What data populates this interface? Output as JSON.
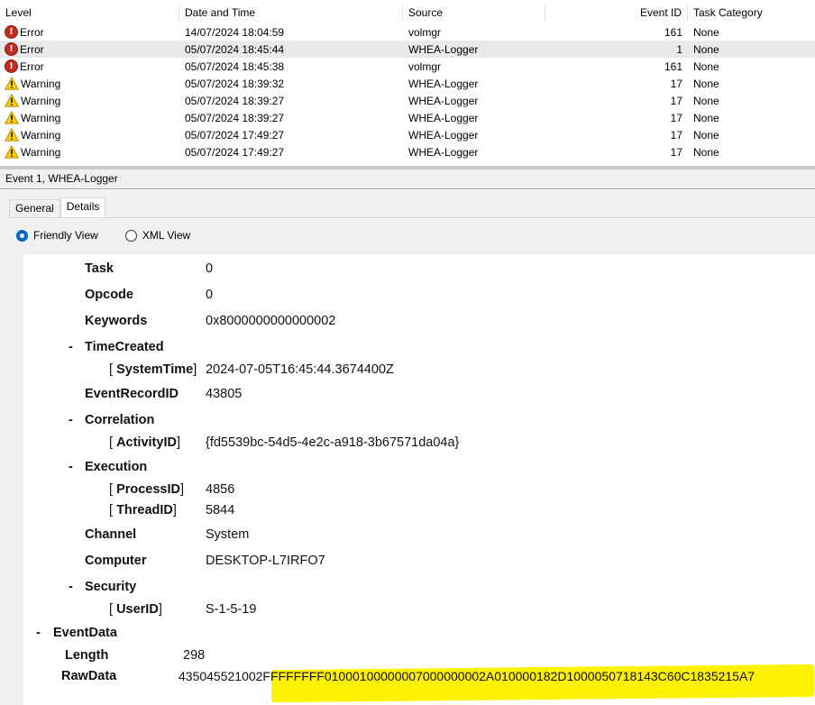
{
  "list": {
    "columns": [
      {
        "label": "Level"
      },
      {
        "label": "Date and Time"
      },
      {
        "label": "Source"
      },
      {
        "label": "Event ID"
      },
      {
        "label": "Task Category"
      }
    ],
    "rows": [
      {
        "level": "Error",
        "icon": "error-icon",
        "datetime": "14/07/2024 18:04:59",
        "source": "volmgr",
        "event_id": "161",
        "category": "None"
      },
      {
        "level": "Error",
        "icon": "error-icon",
        "datetime": "05/07/2024 18:45:44",
        "source": "WHEA-Logger",
        "event_id": "1",
        "category": "None",
        "selected": true
      },
      {
        "level": "Error",
        "icon": "error-icon",
        "datetime": "05/07/2024 18:45:38",
        "source": "volmgr",
        "event_id": "161",
        "category": "None"
      },
      {
        "level": "Warning",
        "icon": "warning-icon",
        "datetime": "05/07/2024 18:39:32",
        "source": "WHEA-Logger",
        "event_id": "17",
        "category": "None"
      },
      {
        "level": "Warning",
        "icon": "warning-icon",
        "datetime": "05/07/2024 18:39:27",
        "source": "WHEA-Logger",
        "event_id": "17",
        "category": "None"
      },
      {
        "level": "Warning",
        "icon": "warning-icon",
        "datetime": "05/07/2024 18:39:27",
        "source": "WHEA-Logger",
        "event_id": "17",
        "category": "None"
      },
      {
        "level": "Warning",
        "icon": "warning-icon",
        "datetime": "05/07/2024 17:49:27",
        "source": "WHEA-Logger",
        "event_id": "17",
        "category": "None"
      },
      {
        "level": "Warning",
        "icon": "warning-icon",
        "datetime": "05/07/2024 17:49:27",
        "source": "WHEA-Logger",
        "event_id": "17",
        "category": "None"
      }
    ]
  },
  "details": {
    "title": "Event 1, WHEA-Logger",
    "tabs": [
      "General",
      "Details"
    ],
    "active_tab": "Details",
    "views": {
      "friendly": "Friendly View",
      "xml": "XML View",
      "selected": "Friendly View"
    },
    "system": {
      "task_label": "Task",
      "task": "0",
      "opcode_label": "Opcode",
      "opcode": "0",
      "keywords_label": "Keywords",
      "keywords": "0x8000000000000002",
      "timecreated_label": "TimeCreated",
      "systemtime_label": "SystemTime",
      "systemtime": "2024-07-05T16:45:44.3674400Z",
      "eventrecordid_label": "EventRecordID",
      "eventrecordid": "43805",
      "correlation_label": "Correlation",
      "activityid_label": "ActivityID",
      "activityid": "{fd5539bc-54d5-4e2c-a918-3b67571da04a}",
      "execution_label": "Execution",
      "processid_label": "ProcessID",
      "processid": "4856",
      "threadid_label": "ThreadID",
      "threadid": "5844",
      "channel_label": "Channel",
      "channel": "System",
      "computer_label": "Computer",
      "computer": "DESKTOP-L7IRFO7",
      "security_label": "Security",
      "userid_label": "UserID",
      "userid": "S-1-5-19"
    },
    "eventdata": {
      "label": "EventData",
      "length_label": "Length",
      "length": "298",
      "rawdata_label": "RawData",
      "rawdata": "435045521002FFFFFFFF01000100000007000000002A010000182D1000050718143C60C1835215A7"
    },
    "expander": "-",
    "bracket_open": "[",
    "bracket_close": "]",
    "highlight_color": "#fff200"
  }
}
